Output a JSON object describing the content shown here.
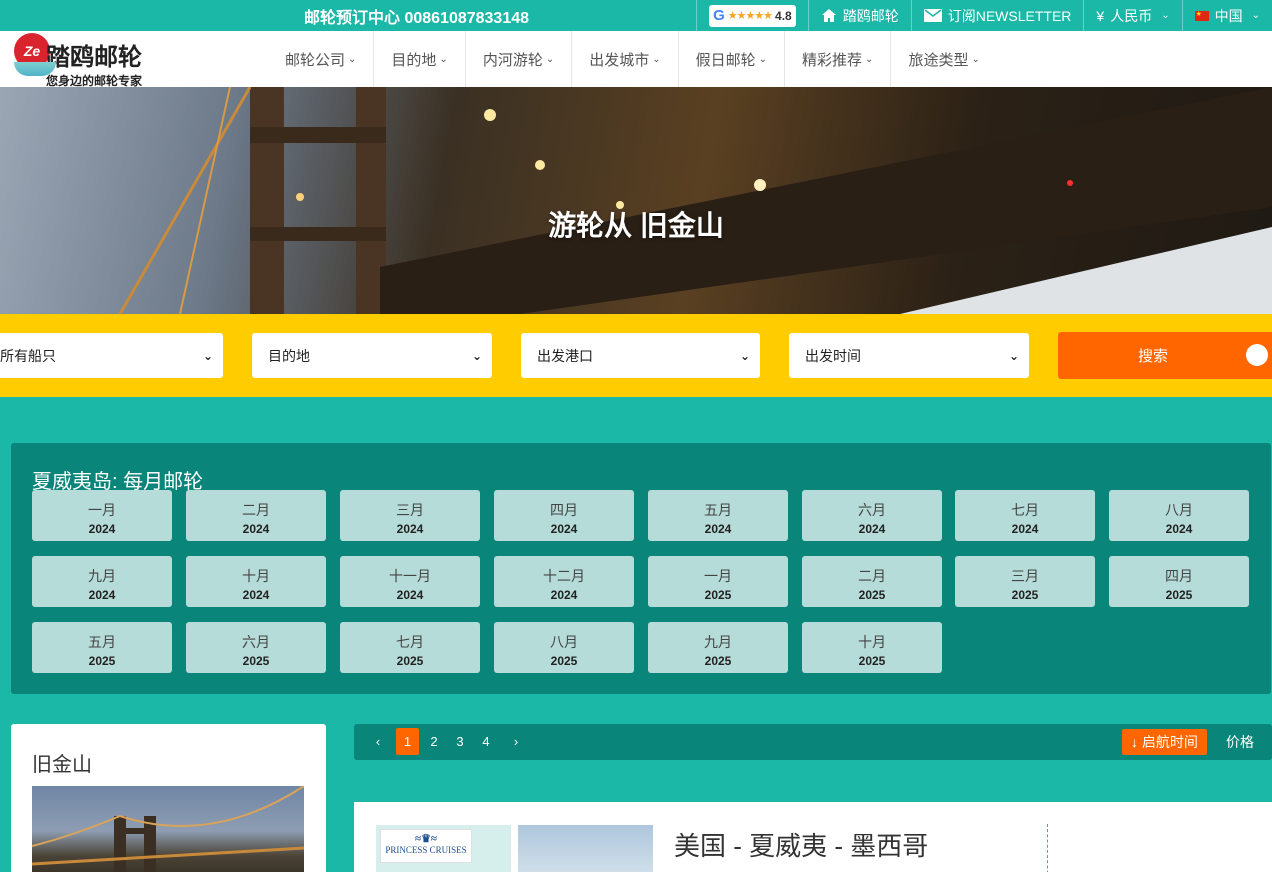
{
  "header": {
    "phone": "邮轮预订中心 00861087833148",
    "google_rating": {
      "stars": "★★★★★",
      "score": "4.8"
    },
    "home_label": "踏鸥邮轮",
    "newsletter_label": "订阅NEWSLETTER",
    "currency_symbol": "¥",
    "currency_label": "人民币",
    "country_label": "中国"
  },
  "logo": {
    "mark": "Ze",
    "title": "踏鸥邮轮",
    "subtitle": "您身边的邮轮专家"
  },
  "menu": [
    {
      "label": "邮轮公司"
    },
    {
      "label": "目的地"
    },
    {
      "label": "内河游轮"
    },
    {
      "label": "出发城市"
    },
    {
      "label": "假日邮轮"
    },
    {
      "label": "精彩推荐"
    },
    {
      "label": "旅途类型"
    }
  ],
  "hero": {
    "title": "游轮从 旧金山"
  },
  "search": {
    "ship": "所有船只",
    "destination": "目的地",
    "port": "出发港口",
    "date": "出发时间",
    "button": "搜索"
  },
  "months": {
    "title": "夏威夷岛: 每月邮轮",
    "items": [
      {
        "month": "一月",
        "year": "2024"
      },
      {
        "month": "二月",
        "year": "2024"
      },
      {
        "month": "三月",
        "year": "2024"
      },
      {
        "month": "四月",
        "year": "2024"
      },
      {
        "month": "五月",
        "year": "2024"
      },
      {
        "month": "六月",
        "year": "2024"
      },
      {
        "month": "七月",
        "year": "2024"
      },
      {
        "month": "八月",
        "year": "2024"
      },
      {
        "month": "九月",
        "year": "2024"
      },
      {
        "month": "十月",
        "year": "2024"
      },
      {
        "month": "十一月",
        "year": "2024"
      },
      {
        "month": "十二月",
        "year": "2024"
      },
      {
        "month": "一月",
        "year": "2025"
      },
      {
        "month": "二月",
        "year": "2025"
      },
      {
        "month": "三月",
        "year": "2025"
      },
      {
        "month": "四月",
        "year": "2025"
      },
      {
        "month": "五月",
        "year": "2025"
      },
      {
        "month": "六月",
        "year": "2025"
      },
      {
        "month": "七月",
        "year": "2025"
      },
      {
        "month": "八月",
        "year": "2025"
      },
      {
        "month": "九月",
        "year": "2025"
      },
      {
        "month": "十月",
        "year": "2025"
      }
    ]
  },
  "city": {
    "title": "旧金山"
  },
  "pager": {
    "prev": "‹",
    "next": "›",
    "pages": [
      "1",
      "2",
      "3",
      "4"
    ],
    "active": "1",
    "sort_date": "↓ 启航时间",
    "sort_price": "价格"
  },
  "result": {
    "title": "美国 - 夏威夷 - 墨西哥",
    "brand_logo_text": "PRINCESS CRUISES"
  },
  "colors": {
    "teal": "#1bb8a8",
    "dark_teal": "#0a857a",
    "yellow": "#ffcc00",
    "orange": "#ff6600"
  }
}
